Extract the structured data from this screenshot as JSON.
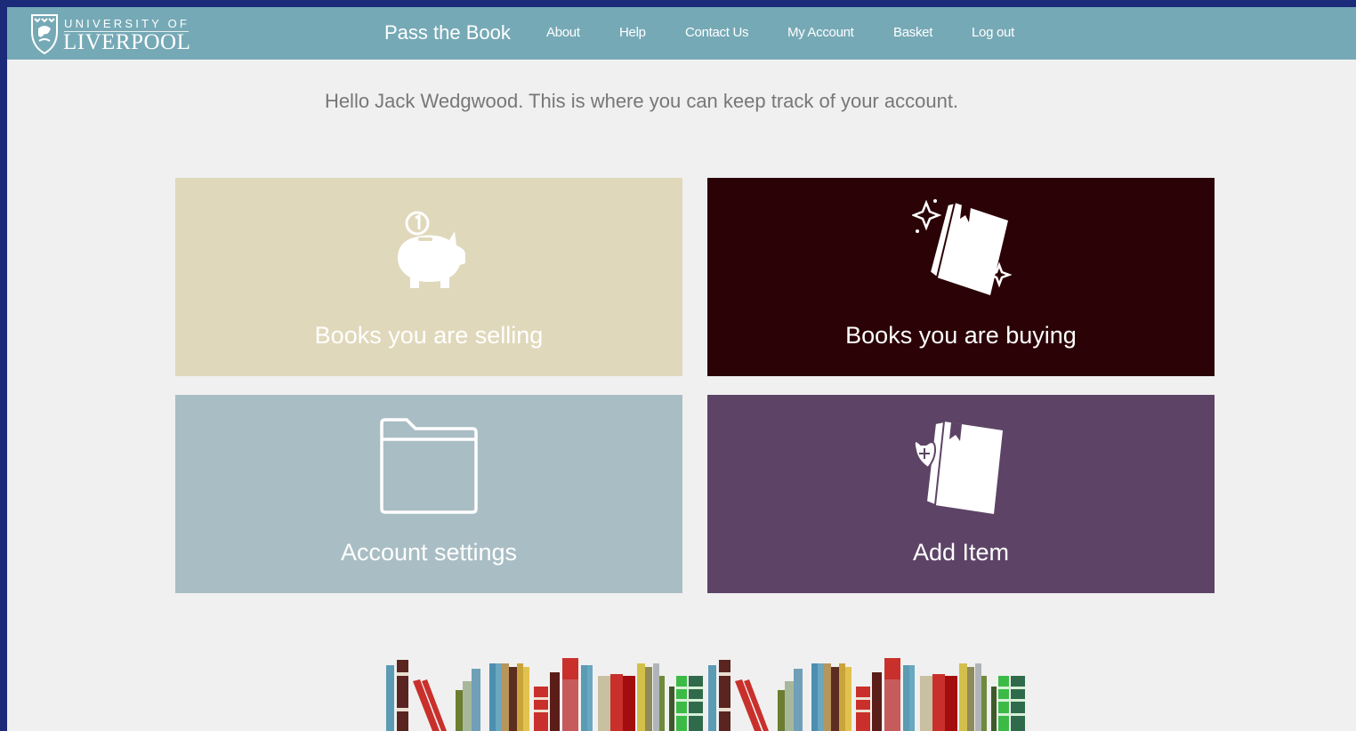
{
  "navbar": {
    "logo": {
      "line1": "UNIVERSITY OF",
      "line2": "LIVERPOOL"
    },
    "brand": "Pass the Book",
    "links": [
      "About",
      "Help",
      "Contact Us",
      "My Account",
      "Basket",
      "Log out"
    ]
  },
  "greeting": "Hello Jack Wedgwood. This is where you can keep track of your account.",
  "tiles": [
    {
      "label": "Books you are selling",
      "color": "#e0d8bb",
      "icon": "piggy-bank-icon"
    },
    {
      "label": "Books you are buying",
      "color": "#2b0206",
      "icon": "sparkle-book-icon"
    },
    {
      "label": "Account settings",
      "color": "#a9bdc4",
      "icon": "folder-icon"
    },
    {
      "label": "Add Item",
      "color": "#5d4466",
      "icon": "add-book-icon"
    }
  ],
  "colors": {
    "page_border": "#1c2a7a",
    "navbar": "#76a9b6",
    "background": "#f0f0f0",
    "greeting_text": "#777777"
  }
}
